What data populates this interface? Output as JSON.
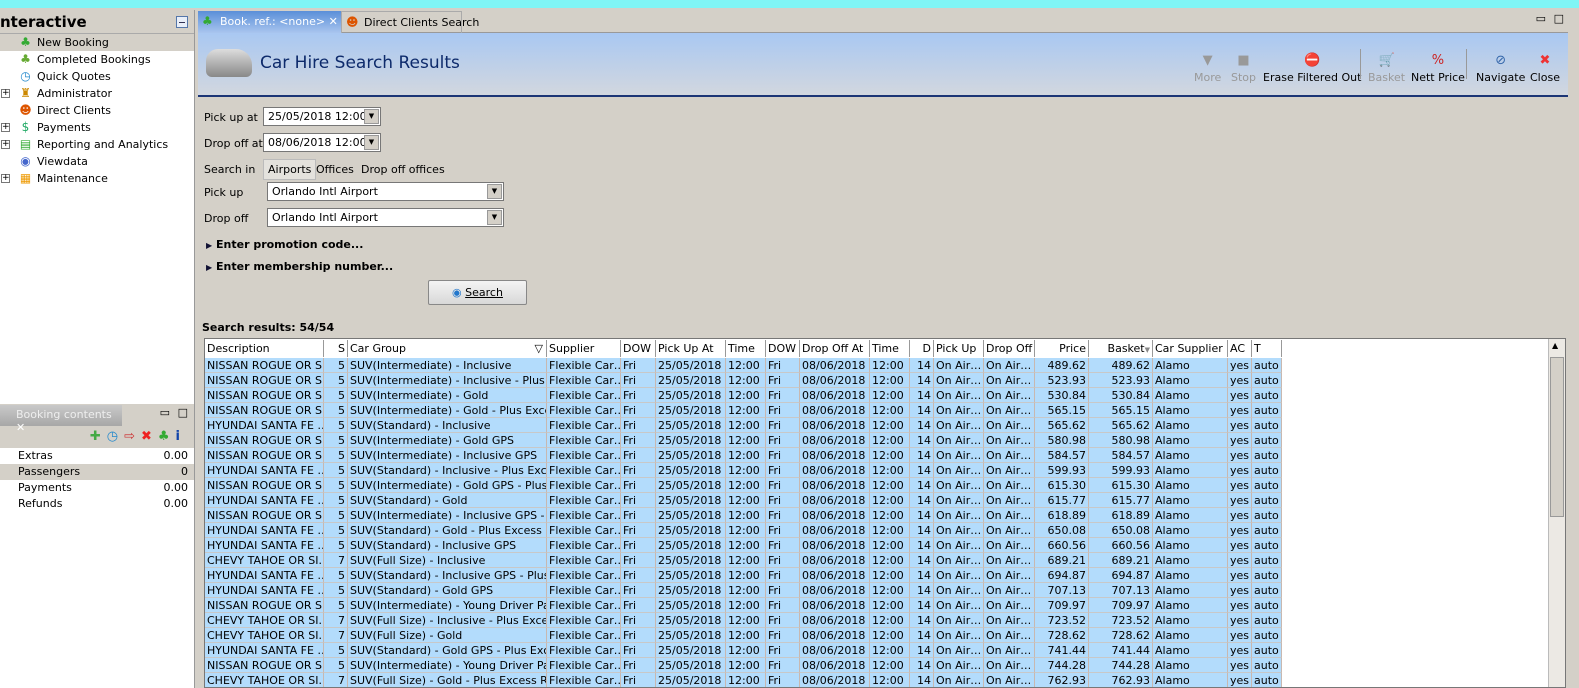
{
  "sidebar": {
    "title": "nteractive",
    "items": [
      {
        "label": "New Booking",
        "icon": "palm-tree-icon",
        "expandable": false,
        "selected": true
      },
      {
        "label": "Completed Bookings",
        "icon": "palm-money-icon",
        "expandable": false
      },
      {
        "label": "Quick Quotes",
        "icon": "clock-icon",
        "expandable": false
      },
      {
        "label": "Administrator",
        "icon": "runner-icon",
        "expandable": true
      },
      {
        "label": "Direct Clients",
        "icon": "client-icon",
        "expandable": false
      },
      {
        "label": "Payments",
        "icon": "card-dollar-icon",
        "expandable": true
      },
      {
        "label": "Reporting and Analytics",
        "icon": "report-icon",
        "expandable": true
      },
      {
        "label": "Viewdata",
        "icon": "globe-icon",
        "expandable": false
      },
      {
        "label": "Maintenance",
        "icon": "toolbox-icon",
        "expandable": true
      }
    ]
  },
  "booking_contents": {
    "tab": "Booking contents",
    "rows": [
      {
        "label": "Extras",
        "value": "0.00"
      },
      {
        "label": "Passengers",
        "value": "0"
      },
      {
        "label": "Payments",
        "value": "0.00"
      },
      {
        "label": "Refunds",
        "value": "0.00"
      }
    ]
  },
  "tabs": [
    {
      "label": "Book. ref.: <none>"
    },
    {
      "label": "Direct Clients Search"
    }
  ],
  "header": {
    "title": "Car Hire Search Results"
  },
  "toolbar": {
    "more": "More",
    "stop": "Stop",
    "erase": "Erase Filtered Out",
    "basket": "Basket",
    "nett": "Nett Price",
    "navigate": "Navigate",
    "close": "Close"
  },
  "form": {
    "pickup_at_label": "Pick up at",
    "pickup_at": "25/05/2018 12:00",
    "dropoff_at_label": "Drop off at",
    "dropoff_at": "08/06/2018 12:00",
    "search_in_label": "Search in",
    "search_in_options": [
      "Airports",
      "Offices",
      "Drop off offices"
    ],
    "pickup_label": "Pick up",
    "pickup": "Orlando Intl Airport",
    "dropoff_label": "Drop off",
    "dropoff": "Orlando Intl Airport",
    "promo": "Enter promotion code...",
    "membership": "Enter membership number...",
    "search": "Search"
  },
  "results": {
    "label": "Search results: 54/54",
    "columns": [
      "Description",
      "S",
      "Car Group",
      "Supplier",
      "DOW",
      "Pick Up At",
      "Time",
      "DOW",
      "Drop Off At",
      "Time",
      "D",
      "Pick Up",
      "Drop Off",
      "Price",
      "Basket",
      "Car Supplier",
      "AC",
      "T"
    ],
    "common": {
      "supplier": "Flexible Car…",
      "dow": "Fri",
      "pickup_date": "25/05/2018",
      "time": "12:00",
      "dropoff_date": "08/06/2018",
      "days": "14",
      "pickup_loc": "On Air…",
      "dropoff_loc": "On Air…",
      "car_supplier": "Alamo",
      "ac": "yes",
      "trans": "auto"
    },
    "rows": [
      [
        "NISSAN ROGUE OR S…",
        "5",
        "SUV(Intermediate) - Inclusive",
        "489.62"
      ],
      [
        "NISSAN ROGUE OR S…",
        "5",
        "SUV(Intermediate) - Inclusive - Plus E…",
        "523.93"
      ],
      [
        "NISSAN ROGUE OR S…",
        "5",
        "SUV(Intermediate) - Gold",
        "530.84"
      ],
      [
        "NISSAN ROGUE OR S…",
        "5",
        "SUV(Intermediate) - Gold - Plus Exces…",
        "565.15"
      ],
      [
        "HYUNDAI SANTA FE …",
        "5",
        "SUV(Standard) - Inclusive",
        "565.62"
      ],
      [
        "NISSAN ROGUE OR S…",
        "5",
        "SUV(Intermediate) - Gold GPS",
        "580.98"
      ],
      [
        "NISSAN ROGUE OR S…",
        "5",
        "SUV(Intermediate) - Inclusive GPS",
        "584.57"
      ],
      [
        "HYUNDAI SANTA FE …",
        "5",
        "SUV(Standard) - Inclusive - Plus Exce…",
        "599.93"
      ],
      [
        "NISSAN ROGUE OR S…",
        "5",
        "SUV(Intermediate) - Gold GPS - Plus E…",
        "615.30"
      ],
      [
        "HYUNDAI SANTA FE …",
        "5",
        "SUV(Standard) - Gold",
        "615.77"
      ],
      [
        "NISSAN ROGUE OR S…",
        "5",
        "SUV(Intermediate) - Inclusive GPS - Pl…",
        "618.89"
      ],
      [
        "HYUNDAI SANTA FE …",
        "5",
        "SUV(Standard) - Gold - Plus Excess R…",
        "650.08"
      ],
      [
        "HYUNDAI SANTA FE …",
        "5",
        "SUV(Standard) - Inclusive GPS",
        "660.56"
      ],
      [
        "CHEVY TAHOE OR SI…",
        "7",
        "SUV(Full Size) - Inclusive",
        "689.21"
      ],
      [
        "HYUNDAI SANTA FE …",
        "5",
        "SUV(Standard) - Inclusive GPS - Plus …",
        "694.87"
      ],
      [
        "HYUNDAI SANTA FE …",
        "5",
        "SUV(Standard) - Gold GPS",
        "707.13"
      ],
      [
        "NISSAN ROGUE OR S…",
        "5",
        "SUV(Intermediate) - Young Driver Pac…",
        "709.97"
      ],
      [
        "CHEVY TAHOE OR SI…",
        "7",
        "SUV(Full Size) - Inclusive - Plus Excess…",
        "723.52"
      ],
      [
        "CHEVY TAHOE OR SI…",
        "7",
        "SUV(Full Size) - Gold",
        "728.62"
      ],
      [
        "HYUNDAI SANTA FE …",
        "5",
        "SUV(Standard) - Gold GPS - Plus Exce…",
        "741.44"
      ],
      [
        "NISSAN ROGUE OR S…",
        "5",
        "SUV(Intermediate) - Young Driver Pac…",
        "744.28"
      ],
      [
        "CHEVY TAHOE OR SI…",
        "7",
        "SUV(Full Size) - Gold - Plus Excess Ref…",
        "762.93"
      ]
    ]
  }
}
